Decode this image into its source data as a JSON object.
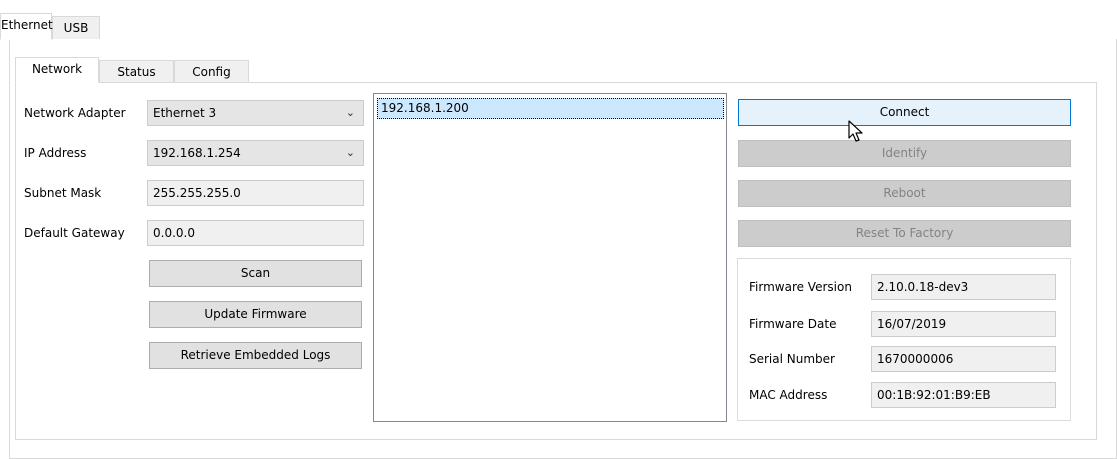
{
  "outer_tabs": [
    {
      "label": "Ethernet",
      "active": true
    },
    {
      "label": "USB",
      "active": false
    }
  ],
  "inner_tabs": [
    {
      "label": "Network",
      "active": true
    },
    {
      "label": "Status",
      "active": false
    },
    {
      "label": "Config",
      "active": false
    }
  ],
  "network": {
    "adapter_label": "Network Adapter",
    "adapter_value": "Ethernet 3",
    "ip_label": "IP Address",
    "ip_value": "192.168.1.254",
    "subnet_label": "Subnet Mask",
    "subnet_value": "255.255.255.0",
    "gateway_label": "Default Gateway",
    "gateway_value": "0.0.0.0",
    "dropdown_icon": "chevron-down-icon"
  },
  "buttons": {
    "scan": "Scan",
    "update_firmware": "Update Firmware",
    "retrieve_logs": "Retrieve Embedded Logs",
    "connect": "Connect",
    "identify": "Identify",
    "reboot": "Reboot",
    "reset_factory": "Reset To Factory"
  },
  "device_list": {
    "items": [
      "192.168.1.200"
    ],
    "selected_index": 0
  },
  "device_info": {
    "firmware_version_label": "Firmware Version",
    "firmware_version_value": "2.10.0.18-dev3",
    "firmware_date_label": "Firmware Date",
    "firmware_date_value": "16/07/2019",
    "serial_label": "Serial Number",
    "serial_value": "1670000006",
    "mac_label": "MAC Address",
    "mac_value": "00:1B:92:01:B9:EB"
  },
  "colors": {
    "accent": "#0078d7",
    "selection": "#cce8ff",
    "disabled_text": "#838383"
  }
}
